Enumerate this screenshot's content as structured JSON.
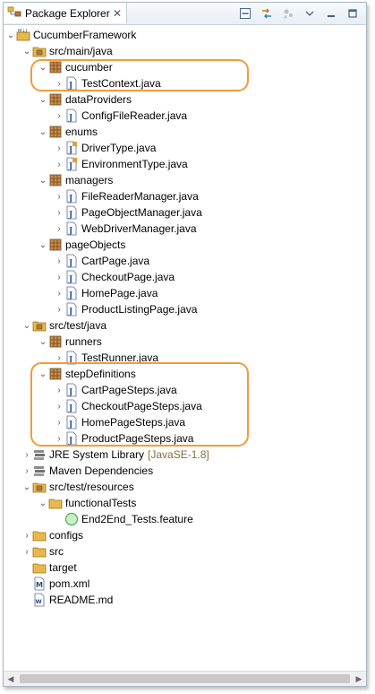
{
  "tab": {
    "title": "Package Explorer",
    "close": "✕"
  },
  "toolbar": {
    "collapse": "collapse-all",
    "link": "link-with-editor",
    "focus": "focus-on-active-task",
    "menu": "view-menu",
    "minimize": "minimize",
    "maximize": "maximize"
  },
  "tree": {
    "project": "CucumberFramework",
    "src_main_java": "src/main/java",
    "pkg_cucumber": "cucumber",
    "file_testcontext": "TestContext.java",
    "pkg_dataproviders": "dataProviders",
    "file_configfilereader": "ConfigFileReader.java",
    "pkg_enums": "enums",
    "file_drivertype": "DriverType.java",
    "file_environmenttype": "EnvironmentType.java",
    "pkg_managers": "managers",
    "file_filereadermanager": "FileReaderManager.java",
    "file_pageobjectmanager": "PageObjectManager.java",
    "file_webdrivermanager": "WebDriverManager.java",
    "pkg_pageobjects": "pageObjects",
    "file_cartpage": "CartPage.java",
    "file_checkoutpage": "CheckoutPage.java",
    "file_homepage": "HomePage.java",
    "file_productlistingpage": "ProductListingPage.java",
    "src_test_java": "src/test/java",
    "pkg_runners": "runners",
    "file_testrunner": "TestRunner.java",
    "pkg_stepdefinitions": "stepDefinitions",
    "file_cartpagesteps": "CartPageSteps.java",
    "file_checkoutpagesteps": "CheckoutPageSteps.java",
    "file_homepagesteps": "HomePageSteps.java",
    "file_productpagesteps": "ProductPageSteps.java",
    "jre_library": "JRE System Library",
    "jre_version": "[JavaSE-1.8]",
    "maven_dependencies": "Maven Dependencies",
    "src_test_resources": "src/test/resources",
    "folder_functionaltests": "functionalTests",
    "file_feature": "End2End_Tests.feature",
    "folder_configs": "configs",
    "folder_src": "src",
    "folder_target": "target",
    "file_pom": "pom.xml",
    "file_readme": "README.md"
  },
  "colors": {
    "highlight": "#f39a3c",
    "package": "#8b5a2b",
    "folder": "#e8b84a",
    "java": "#2b5ea7"
  }
}
